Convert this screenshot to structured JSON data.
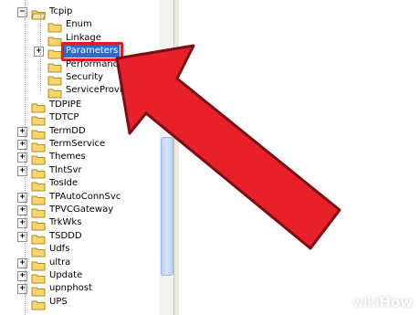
{
  "tree": {
    "top": {
      "label": "Tcpip",
      "expander": "−"
    },
    "children": [
      {
        "label": "Enum"
      },
      {
        "label": "Linkage"
      },
      {
        "label": "Parameters",
        "expander": "+",
        "selected": true
      },
      {
        "label": "Performance"
      },
      {
        "label": "Security"
      },
      {
        "label": "ServiceProvider"
      }
    ],
    "siblings": [
      {
        "label": "TDPIPE",
        "expander": ""
      },
      {
        "label": "TDTCP",
        "expander": ""
      },
      {
        "label": "TermDD",
        "expander": "+"
      },
      {
        "label": "TermService",
        "expander": "+"
      },
      {
        "label": "Themes",
        "expander": "+"
      },
      {
        "label": "TlntSvr",
        "expander": "+"
      },
      {
        "label": "TosIde",
        "expander": ""
      },
      {
        "label": "TPAutoConnSvc",
        "expander": "+"
      },
      {
        "label": "TPVCGateway",
        "expander": "+"
      },
      {
        "label": "TrkWks",
        "expander": "+"
      },
      {
        "label": "TSDDD",
        "expander": "+"
      },
      {
        "label": "Udfs",
        "expander": ""
      },
      {
        "label": "ultra",
        "expander": "+"
      },
      {
        "label": "Update",
        "expander": "+"
      },
      {
        "label": "upnphost",
        "expander": "+"
      },
      {
        "label": "UPS",
        "expander": ""
      }
    ]
  },
  "watermark": {
    "wiki": "wiki",
    "how": "How"
  },
  "colors": {
    "arrow": "#e8202a",
    "arrow_outline": "#7a0f12",
    "selection": "#316ac5",
    "highlight": "#e01b24",
    "folder": "#f7d56b"
  }
}
